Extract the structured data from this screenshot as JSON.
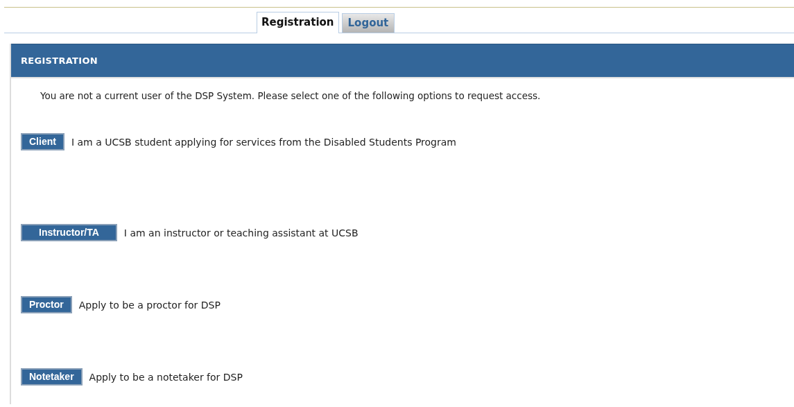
{
  "tabs": [
    {
      "label": "Registration",
      "selected": true
    },
    {
      "label": "Logout",
      "selected": false
    }
  ],
  "panel": {
    "title": "REGISTRATION",
    "intro": "You are not a current user of the DSP System. Please select one of the following options to request access.",
    "options": [
      {
        "button": "Client",
        "description": "I am a UCSB student applying for services from the Disabled Students Program"
      },
      {
        "button": "Instructor/TA",
        "description": "I am an instructor or teaching assistant at UCSB"
      },
      {
        "button": "Proctor",
        "description": "Apply to be a proctor for DSP"
      },
      {
        "button": "Notetaker",
        "description": "Apply to be a notetaker for DSP"
      }
    ]
  }
}
